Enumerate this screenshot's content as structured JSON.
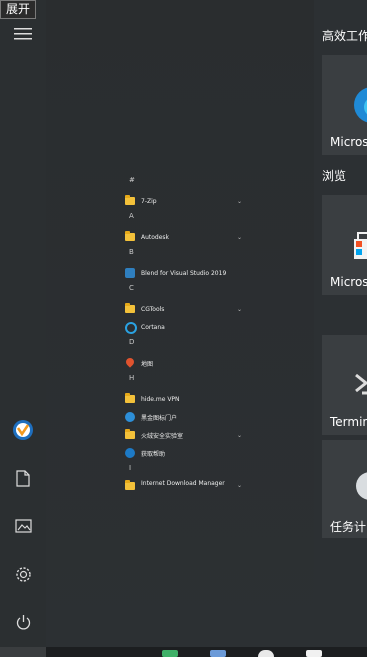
{
  "tooltip": {
    "text": "展开"
  },
  "rail": {
    "items": [
      {
        "icon": "hamburger-icon"
      },
      {
        "icon": "avatar-icon"
      },
      {
        "icon": "document-icon"
      },
      {
        "icon": "picture-icon"
      },
      {
        "icon": "gear-icon"
      },
      {
        "icon": "power-icon"
      }
    ]
  },
  "app_list": {
    "groups": [
      {
        "header": "#",
        "apps": [
          {
            "label": "7-Zip",
            "icon": "folder-icon",
            "expandable": true
          }
        ]
      },
      {
        "header": "A",
        "apps": [
          {
            "label": "Autodesk",
            "icon": "folder-icon",
            "expandable": true
          }
        ]
      },
      {
        "header": "B",
        "apps": [
          {
            "label": "Blend for Visual Studio 2019",
            "icon": "blend-icon",
            "expandable": false
          }
        ]
      },
      {
        "header": "C",
        "apps": [
          {
            "label": "CGTools",
            "icon": "folder-icon",
            "expandable": true
          },
          {
            "label": "Cortana",
            "icon": "cortana-icon",
            "expandable": false
          }
        ]
      },
      {
        "header": "D",
        "apps": [
          {
            "label": "地图",
            "icon": "maps-icon",
            "expandable": false
          }
        ]
      },
      {
        "header": "H",
        "apps": [
          {
            "label": "hide.me VPN",
            "icon": "folder-icon",
            "expandable": true
          },
          {
            "label": "黑金图标门户",
            "icon": "vpn-icon",
            "expandable": false
          },
          {
            "label": "火绒安全实验室",
            "icon": "folder-icon",
            "expandable": true
          },
          {
            "label": "获取帮助",
            "icon": "help-icon",
            "expandable": false
          }
        ]
      },
      {
        "header": "I",
        "apps": [
          {
            "label": "Internet Download Manager",
            "icon": "folder-icon",
            "expandable": true
          }
        ]
      }
    ]
  },
  "tiles_panel": {
    "sections": [
      {
        "title": "高效工作",
        "tiles": [
          {
            "label": "Microso",
            "icon": "edge-icon"
          }
        ]
      },
      {
        "title": "浏览",
        "tiles": [
          {
            "label": "Microso",
            "icon": "store-icon"
          },
          {
            "label": "Termina",
            "icon": "terminal-icon"
          },
          {
            "label": "任务计",
            "icon": "clock-icon"
          }
        ]
      }
    ]
  },
  "colors": {
    "accent": "#2aa2e2",
    "folder": "#f3c13a",
    "background": "#2b2e30",
    "tile": "#3a3e41"
  }
}
